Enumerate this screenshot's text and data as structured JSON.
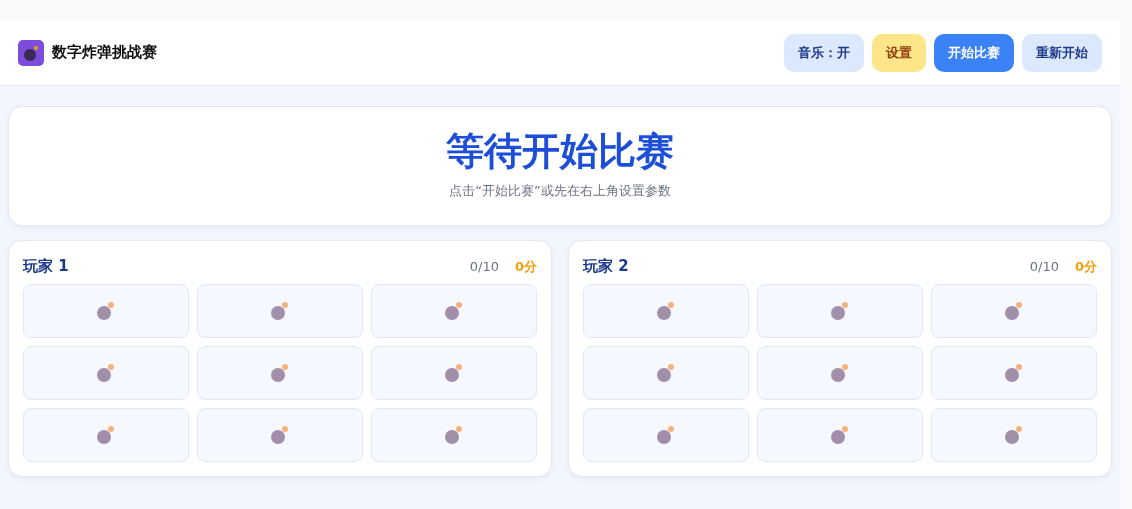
{
  "header": {
    "title": "数字炸弹挑战赛",
    "buttons": [
      {
        "label": "音乐：开",
        "kind": "soft"
      },
      {
        "label": "设置",
        "kind": "warning"
      },
      {
        "label": "开始比赛",
        "kind": "primary"
      },
      {
        "label": "重新开始",
        "kind": "soft"
      }
    ]
  },
  "banner": {
    "title": "等待开始比赛",
    "subtitle": "点击“开始比赛”或先在右上角设置参数"
  },
  "players": [
    {
      "name": "玩家 1",
      "progress": "0/10",
      "score": "0分",
      "tiles": [
        {
          "kind": "bomb"
        },
        {
          "kind": "bomb"
        },
        {
          "kind": "bomb"
        },
        {
          "kind": "bomb"
        },
        {
          "kind": "bomb"
        },
        {
          "kind": "bomb"
        },
        {
          "kind": "bomb"
        },
        {
          "kind": "bomb"
        },
        {
          "kind": "bomb"
        }
      ]
    },
    {
      "name": "玩家 2",
      "progress": "0/10",
      "score": "0分",
      "tiles": [
        {
          "kind": "bomb"
        },
        {
          "kind": "bomb"
        },
        {
          "kind": "bomb"
        },
        {
          "kind": "bomb"
        },
        {
          "kind": "bomb"
        },
        {
          "kind": "bomb"
        },
        {
          "kind": "bomb"
        },
        {
          "kind": "bomb"
        },
        {
          "kind": "bomb"
        }
      ]
    }
  ]
}
